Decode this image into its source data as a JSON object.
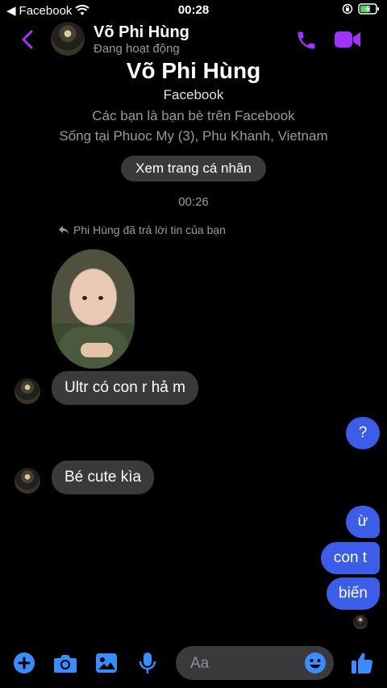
{
  "status_bar": {
    "back_app": "Facebook",
    "time": "00:28"
  },
  "header": {
    "name": "Võ Phi Hùng",
    "status": "Đang hoạt động"
  },
  "profile": {
    "name": "Võ Phi Hùng",
    "source": "Facebook",
    "friends_note": "Các bạn là bạn bè trên Facebook",
    "location": "Sống tại Phuoc My (3), Phu Khanh, Vietnam",
    "view_button": "Xem trang cá nhân"
  },
  "conversation": {
    "timestamp": "00:26",
    "reply_note": "Phi Hùng đã trả lời tin của bạn",
    "incoming": [
      {
        "text": "Ultr có con r hả m"
      },
      {
        "text": "Bé cute kìa"
      }
    ],
    "outgoing": [
      {
        "text": "?"
      },
      {
        "text": "ừ"
      },
      {
        "text": "con t"
      },
      {
        "text": "biến"
      }
    ]
  },
  "composer": {
    "placeholder": "Aa"
  },
  "colors": {
    "accent_purple": "#a033ff",
    "accent_blue": "#3b8cff",
    "bubble_out": "#3b5de7",
    "bubble_in": "#3a3a3c"
  }
}
